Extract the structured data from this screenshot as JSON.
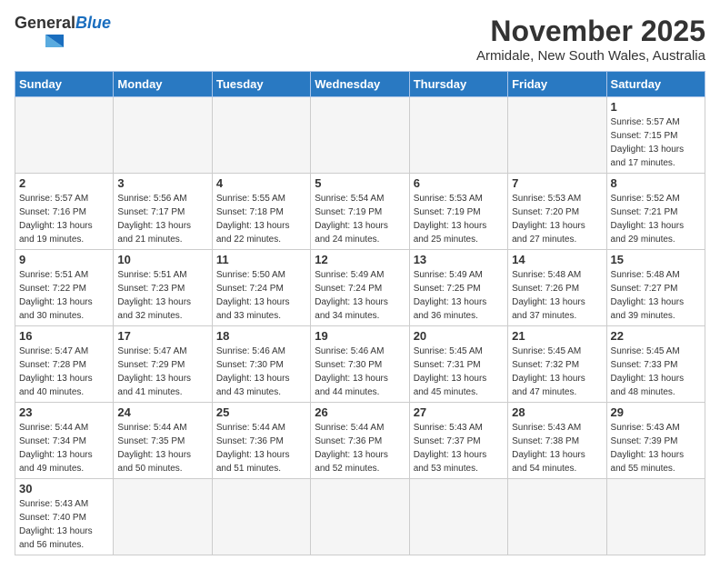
{
  "header": {
    "logo_general": "General",
    "logo_blue": "Blue",
    "month_title": "November 2025",
    "location": "Armidale, New South Wales, Australia"
  },
  "days_of_week": [
    "Sunday",
    "Monday",
    "Tuesday",
    "Wednesday",
    "Thursday",
    "Friday",
    "Saturday"
  ],
  "weeks": [
    [
      {
        "day": "",
        "info": ""
      },
      {
        "day": "",
        "info": ""
      },
      {
        "day": "",
        "info": ""
      },
      {
        "day": "",
        "info": ""
      },
      {
        "day": "",
        "info": ""
      },
      {
        "day": "",
        "info": ""
      },
      {
        "day": "1",
        "info": "Sunrise: 5:57 AM\nSunset: 7:15 PM\nDaylight: 13 hours and 17 minutes."
      }
    ],
    [
      {
        "day": "2",
        "info": "Sunrise: 5:57 AM\nSunset: 7:16 PM\nDaylight: 13 hours and 19 minutes."
      },
      {
        "day": "3",
        "info": "Sunrise: 5:56 AM\nSunset: 7:17 PM\nDaylight: 13 hours and 21 minutes."
      },
      {
        "day": "4",
        "info": "Sunrise: 5:55 AM\nSunset: 7:18 PM\nDaylight: 13 hours and 22 minutes."
      },
      {
        "day": "5",
        "info": "Sunrise: 5:54 AM\nSunset: 7:19 PM\nDaylight: 13 hours and 24 minutes."
      },
      {
        "day": "6",
        "info": "Sunrise: 5:53 AM\nSunset: 7:19 PM\nDaylight: 13 hours and 25 minutes."
      },
      {
        "day": "7",
        "info": "Sunrise: 5:53 AM\nSunset: 7:20 PM\nDaylight: 13 hours and 27 minutes."
      },
      {
        "day": "8",
        "info": "Sunrise: 5:52 AM\nSunset: 7:21 PM\nDaylight: 13 hours and 29 minutes."
      }
    ],
    [
      {
        "day": "9",
        "info": "Sunrise: 5:51 AM\nSunset: 7:22 PM\nDaylight: 13 hours and 30 minutes."
      },
      {
        "day": "10",
        "info": "Sunrise: 5:51 AM\nSunset: 7:23 PM\nDaylight: 13 hours and 32 minutes."
      },
      {
        "day": "11",
        "info": "Sunrise: 5:50 AM\nSunset: 7:24 PM\nDaylight: 13 hours and 33 minutes."
      },
      {
        "day": "12",
        "info": "Sunrise: 5:49 AM\nSunset: 7:24 PM\nDaylight: 13 hours and 34 minutes."
      },
      {
        "day": "13",
        "info": "Sunrise: 5:49 AM\nSunset: 7:25 PM\nDaylight: 13 hours and 36 minutes."
      },
      {
        "day": "14",
        "info": "Sunrise: 5:48 AM\nSunset: 7:26 PM\nDaylight: 13 hours and 37 minutes."
      },
      {
        "day": "15",
        "info": "Sunrise: 5:48 AM\nSunset: 7:27 PM\nDaylight: 13 hours and 39 minutes."
      }
    ],
    [
      {
        "day": "16",
        "info": "Sunrise: 5:47 AM\nSunset: 7:28 PM\nDaylight: 13 hours and 40 minutes."
      },
      {
        "day": "17",
        "info": "Sunrise: 5:47 AM\nSunset: 7:29 PM\nDaylight: 13 hours and 41 minutes."
      },
      {
        "day": "18",
        "info": "Sunrise: 5:46 AM\nSunset: 7:30 PM\nDaylight: 13 hours and 43 minutes."
      },
      {
        "day": "19",
        "info": "Sunrise: 5:46 AM\nSunset: 7:30 PM\nDaylight: 13 hours and 44 minutes."
      },
      {
        "day": "20",
        "info": "Sunrise: 5:45 AM\nSunset: 7:31 PM\nDaylight: 13 hours and 45 minutes."
      },
      {
        "day": "21",
        "info": "Sunrise: 5:45 AM\nSunset: 7:32 PM\nDaylight: 13 hours and 47 minutes."
      },
      {
        "day": "22",
        "info": "Sunrise: 5:45 AM\nSunset: 7:33 PM\nDaylight: 13 hours and 48 minutes."
      }
    ],
    [
      {
        "day": "23",
        "info": "Sunrise: 5:44 AM\nSunset: 7:34 PM\nDaylight: 13 hours and 49 minutes."
      },
      {
        "day": "24",
        "info": "Sunrise: 5:44 AM\nSunset: 7:35 PM\nDaylight: 13 hours and 50 minutes."
      },
      {
        "day": "25",
        "info": "Sunrise: 5:44 AM\nSunset: 7:36 PM\nDaylight: 13 hours and 51 minutes."
      },
      {
        "day": "26",
        "info": "Sunrise: 5:44 AM\nSunset: 7:36 PM\nDaylight: 13 hours and 52 minutes."
      },
      {
        "day": "27",
        "info": "Sunrise: 5:43 AM\nSunset: 7:37 PM\nDaylight: 13 hours and 53 minutes."
      },
      {
        "day": "28",
        "info": "Sunrise: 5:43 AM\nSunset: 7:38 PM\nDaylight: 13 hours and 54 minutes."
      },
      {
        "day": "29",
        "info": "Sunrise: 5:43 AM\nSunset: 7:39 PM\nDaylight: 13 hours and 55 minutes."
      }
    ],
    [
      {
        "day": "30",
        "info": "Sunrise: 5:43 AM\nSunset: 7:40 PM\nDaylight: 13 hours and 56 minutes."
      },
      {
        "day": "",
        "info": ""
      },
      {
        "day": "",
        "info": ""
      },
      {
        "day": "",
        "info": ""
      },
      {
        "day": "",
        "info": ""
      },
      {
        "day": "",
        "info": ""
      },
      {
        "day": "",
        "info": ""
      }
    ]
  ]
}
